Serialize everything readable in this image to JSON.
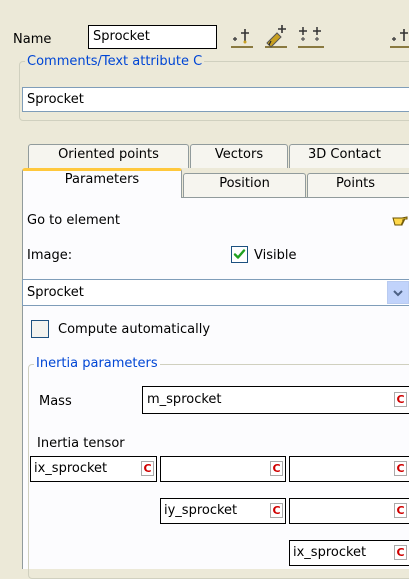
{
  "header": {
    "name_label": "Name",
    "name_value": "Sprocket",
    "toolbar": {
      "icons": [
        "insert-point-icon",
        "edit-element-icon",
        "insert-multiple-icon",
        "insert-point-icon"
      ]
    }
  },
  "comments": {
    "legend": "Comments/Text attribute C",
    "value": "Sprocket"
  },
  "tabs": {
    "row1": [
      "Oriented points",
      "Vectors",
      "3D Contact"
    ],
    "row2": [
      "Parameters",
      "Position",
      "Points"
    ],
    "active": "Parameters"
  },
  "parameters": {
    "goto_label": "Go to element",
    "goto_icon": "pointing-hand-icon",
    "image_label": "Image:",
    "visible_label": "Visible",
    "visible_checked": true,
    "image_select_value": "Sprocket",
    "compute_label": "Compute automatically",
    "compute_checked": false,
    "inertia": {
      "legend": "Inertia parameters",
      "mass_label": "Mass",
      "mass_value": "m_sprocket",
      "tensor_label": "Inertia tensor",
      "c_label": "C",
      "cells": {
        "r1c1": "ix_sprocket",
        "r1c2": "",
        "r1c3": "",
        "r2c2": "iy_sprocket",
        "r2c3": "",
        "r3c3": "ix_sprocket"
      }
    }
  },
  "colors": {
    "window_bg": "#ece9d8",
    "panel_bg": "#fcfcfe",
    "legend_blue": "#0046d5",
    "active_tab_accent": "#ffc83c",
    "c_red": "#d00000",
    "check_green": "#21a121"
  }
}
